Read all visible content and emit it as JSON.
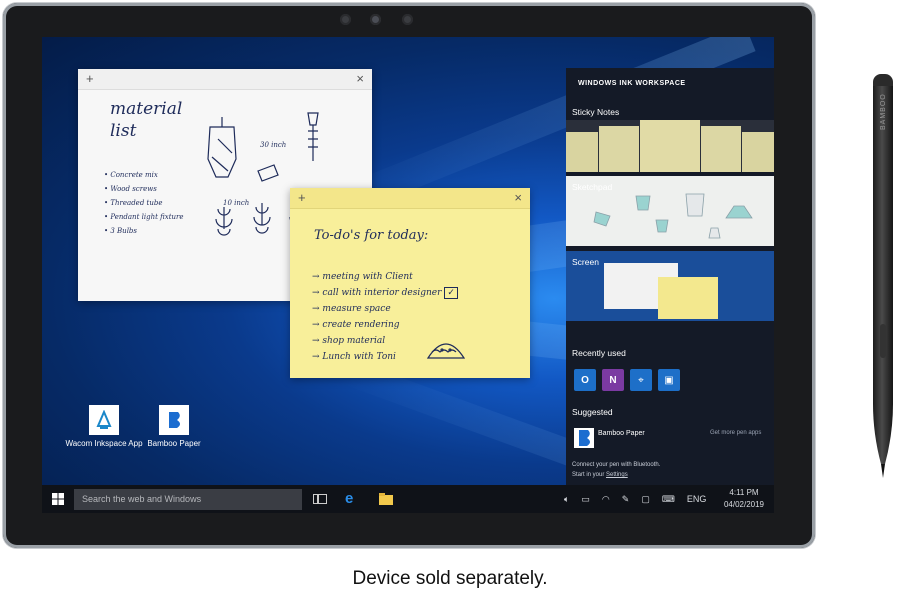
{
  "caption": "Device sold separately.",
  "desktop": {
    "icons": [
      {
        "label": "Wacom Inkspace App",
        "icon": "wacom-inkspace-icon"
      },
      {
        "label": "Bamboo Paper",
        "icon": "bamboo-paper-icon"
      }
    ]
  },
  "sketch_window": {
    "title_lines": [
      "material",
      "list"
    ],
    "items": [
      "Concrete mix",
      "Wood screws",
      "Threaded tube",
      "Pendant light fixture",
      "3 Bulbs"
    ],
    "dimensions": [
      "30 inch",
      "10 inch"
    ]
  },
  "sticky_note": {
    "heading": "To-do's for today:",
    "items": [
      "meeting with Client",
      "call with interior designer",
      "measure space",
      "create rendering",
      "shop material",
      "Lunch with Toni"
    ]
  },
  "ink_workspace": {
    "title": "WINDOWS INK WORKSPACE",
    "sections": {
      "sticky_notes": "Sticky Notes",
      "sketchpad": "Sketchpad",
      "screen": "Screen"
    },
    "recently_used_label": "Recently used",
    "suggested_label": "Suggested",
    "suggested_app": "Bamboo Paper",
    "get_more": "Get more pen apps",
    "bluetooth_text": "Connect your pen with Bluetooth.",
    "settings_text_prefix": "Start in your ",
    "settings_link": "Settings"
  },
  "taskbar": {
    "search_placeholder": "Search the web and Windows",
    "language": "ENG",
    "time": "4:11 PM",
    "date": "04/02/2019"
  },
  "pen": {
    "brand": "BAMBOO"
  },
  "colors": {
    "sticky": "#f8ef9a",
    "desktop_blue": "#1258c4",
    "taskbar": "#0f1218",
    "panel": "#141a27"
  }
}
